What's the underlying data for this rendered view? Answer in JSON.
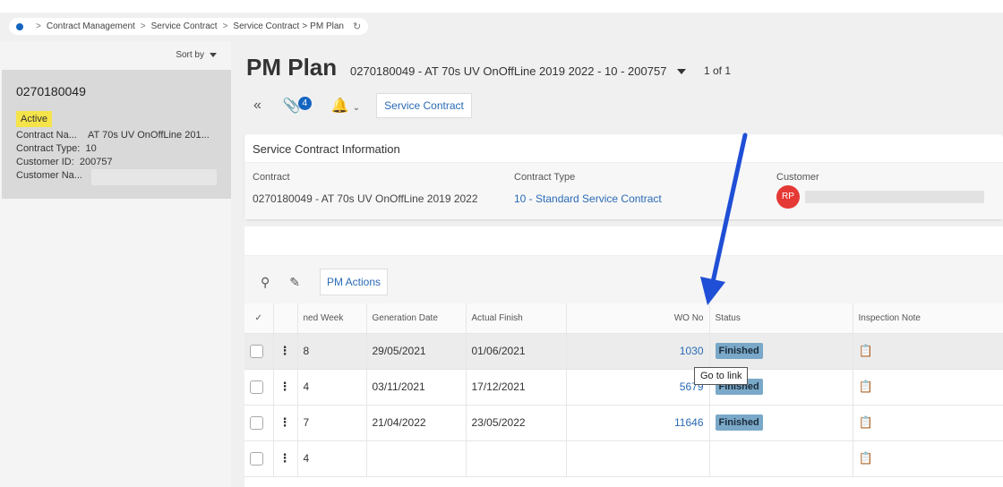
{
  "breadcrumb": {
    "items": [
      "Contract Management",
      "Service Contract",
      "Service Contract"
    ],
    "last_separator": ">",
    "current": "PM Plan"
  },
  "sort": {
    "label": "Sort by"
  },
  "record_card": {
    "id": "0270180049",
    "status": "Active",
    "rows": [
      {
        "label": "Contract Na...",
        "value": "AT 70s UV OnOffLine 201..."
      },
      {
        "label": "Contract Type:",
        "value": "10"
      },
      {
        "label": "Customer ID:",
        "value": "200757"
      },
      {
        "label": "Customer Na...",
        "value": ""
      }
    ]
  },
  "header": {
    "title": "PM Plan",
    "subtitle": "0270180049 - AT 70s UV OnOffLine 2019 2022 - 10 - 200757",
    "count": "1 of 1"
  },
  "toolbar": {
    "attachments_count": "4",
    "service_contract_label": "Service Contract"
  },
  "info": {
    "heading": "Service Contract Information",
    "contract_label": "Contract",
    "contract_value": "0270180049 - AT 70s UV  OnOffLine   2019  2022",
    "type_label": "Contract Type",
    "type_value": "10 - Standard Service Contract",
    "customer_label": "Customer",
    "customer_initials": "RP"
  },
  "table": {
    "pm_actions_label": "PM Actions",
    "columns": [
      "",
      "",
      "ned Week",
      "Generation Date",
      "Actual Finish",
      "WO No",
      "Status",
      "Inspection Note"
    ],
    "rows": [
      {
        "week": "8",
        "gen": "29/05/2021",
        "finish": "01/06/2021",
        "wo": "1030",
        "status": "Finished"
      },
      {
        "week": "4",
        "gen": "03/11/2021",
        "finish": "17/12/2021",
        "wo": "5679",
        "status": "Finished"
      },
      {
        "week": "7",
        "gen": "21/04/2022",
        "finish": "23/05/2022",
        "wo": "11646",
        "status": "Finished"
      },
      {
        "week": "4",
        "gen": "",
        "finish": "",
        "wo": "",
        "status": ""
      }
    ]
  },
  "tooltip": {
    "text": "Go to link"
  },
  "colors": {
    "accent": "#2a6ab5",
    "status_bg": "#7aa8c8",
    "active_badge": "#f5e34a",
    "avatar": "#e53935",
    "arrow": "#1f4fd6"
  }
}
